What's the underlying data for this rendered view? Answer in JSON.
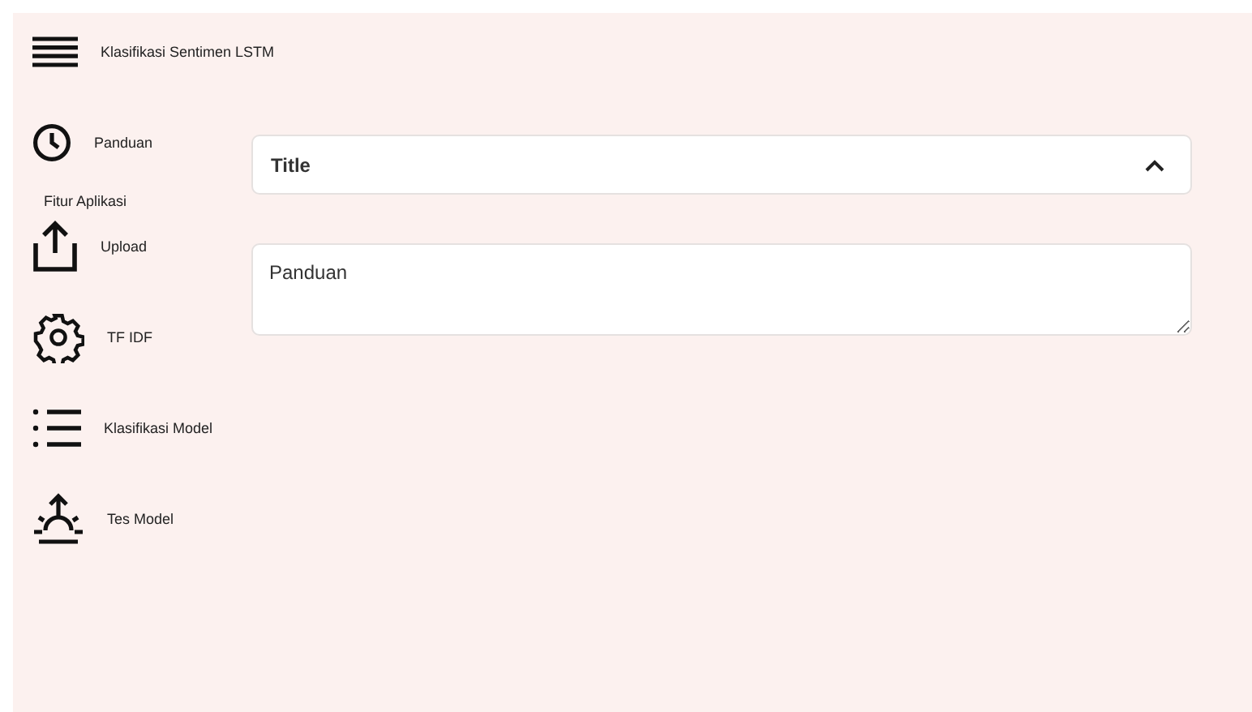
{
  "app_title": "Klasifikasi Sentimen LSTM",
  "sidebar": [
    {
      "kind": "link",
      "label": "Panduan"
    },
    {
      "kind": "heading",
      "label": "Fitur Aplikasi"
    },
    {
      "kind": "link",
      "label": "Upload"
    },
    {
      "kind": "link",
      "label": "TF IDF"
    },
    {
      "kind": "link",
      "label": "Klasifikasi Model"
    },
    {
      "kind": "link",
      "label": "Tes Model"
    }
  ],
  "accordion": {
    "title": "Title",
    "expanded": true
  },
  "text_area": {
    "value": "Panduan"
  }
}
